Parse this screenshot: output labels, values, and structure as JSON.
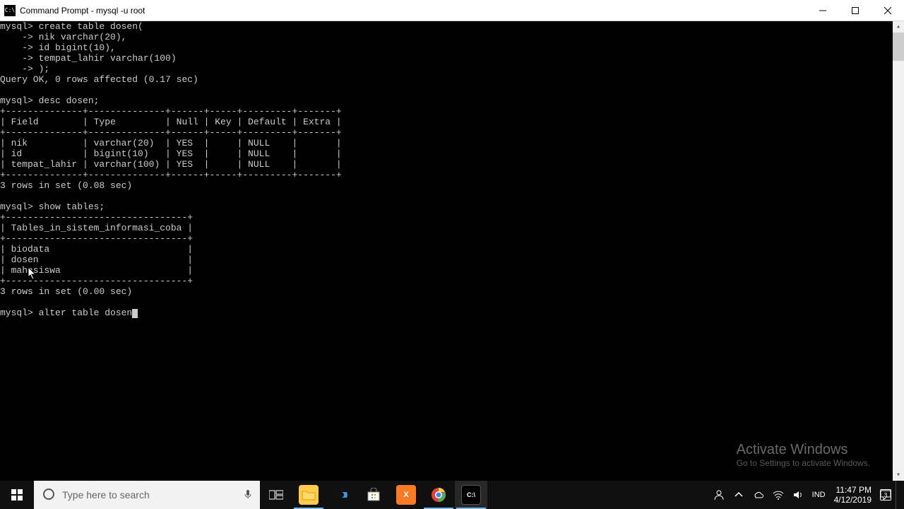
{
  "window": {
    "title": "Command Prompt - mysql  -u root"
  },
  "terminal": {
    "lines": [
      "mysql> create table dosen(",
      "    -> nik varchar(20),",
      "    -> id bigint(10),",
      "    -> tempat_lahir varchar(100)",
      "    -> );",
      "Query OK, 0 rows affected (0.17 sec)",
      "",
      "mysql> desc dosen;",
      "+--------------+--------------+------+-----+---------+-------+",
      "| Field        | Type         | Null | Key | Default | Extra |",
      "+--------------+--------------+------+-----+---------+-------+",
      "| nik          | varchar(20)  | YES  |     | NULL    |       |",
      "| id           | bigint(10)   | YES  |     | NULL    |       |",
      "| tempat_lahir | varchar(100) | YES  |     | NULL    |       |",
      "+--------------+--------------+------+-----+---------+-------+",
      "3 rows in set (0.08 sec)",
      "",
      "mysql> show tables;",
      "+---------------------------------+",
      "| Tables_in_sistem_informasi_coba |",
      "+---------------------------------+",
      "| biodata                         |",
      "| dosen                           |",
      "| mahasiswa                       |",
      "+---------------------------------+",
      "3 rows in set (0.00 sec)",
      "",
      "mysql> alter table dosen"
    ]
  },
  "desc_table": {
    "columns": [
      "Field",
      "Type",
      "Null",
      "Key",
      "Default",
      "Extra"
    ],
    "rows": [
      {
        "Field": "nik",
        "Type": "varchar(20)",
        "Null": "YES",
        "Key": "",
        "Default": "NULL",
        "Extra": ""
      },
      {
        "Field": "id",
        "Type": "bigint(10)",
        "Null": "YES",
        "Key": "",
        "Default": "NULL",
        "Extra": ""
      },
      {
        "Field": "tempat_lahir",
        "Type": "varchar(100)",
        "Null": "YES",
        "Key": "",
        "Default": "NULL",
        "Extra": ""
      }
    ],
    "footer": "3 rows in set (0.08 sec)"
  },
  "show_tables": {
    "header": "Tables_in_sistem_informasi_coba",
    "rows": [
      "biodata",
      "dosen",
      "mahasiswa"
    ],
    "footer": "3 rows in set (0.00 sec)"
  },
  "watermark": {
    "line1": "Activate Windows",
    "line2": "Go to Settings to activate Windows."
  },
  "taskbar": {
    "search_placeholder": "Type here to search",
    "ime": "IND",
    "time": "11:47 PM",
    "date": "4/12/2019",
    "notif_count": "3"
  }
}
